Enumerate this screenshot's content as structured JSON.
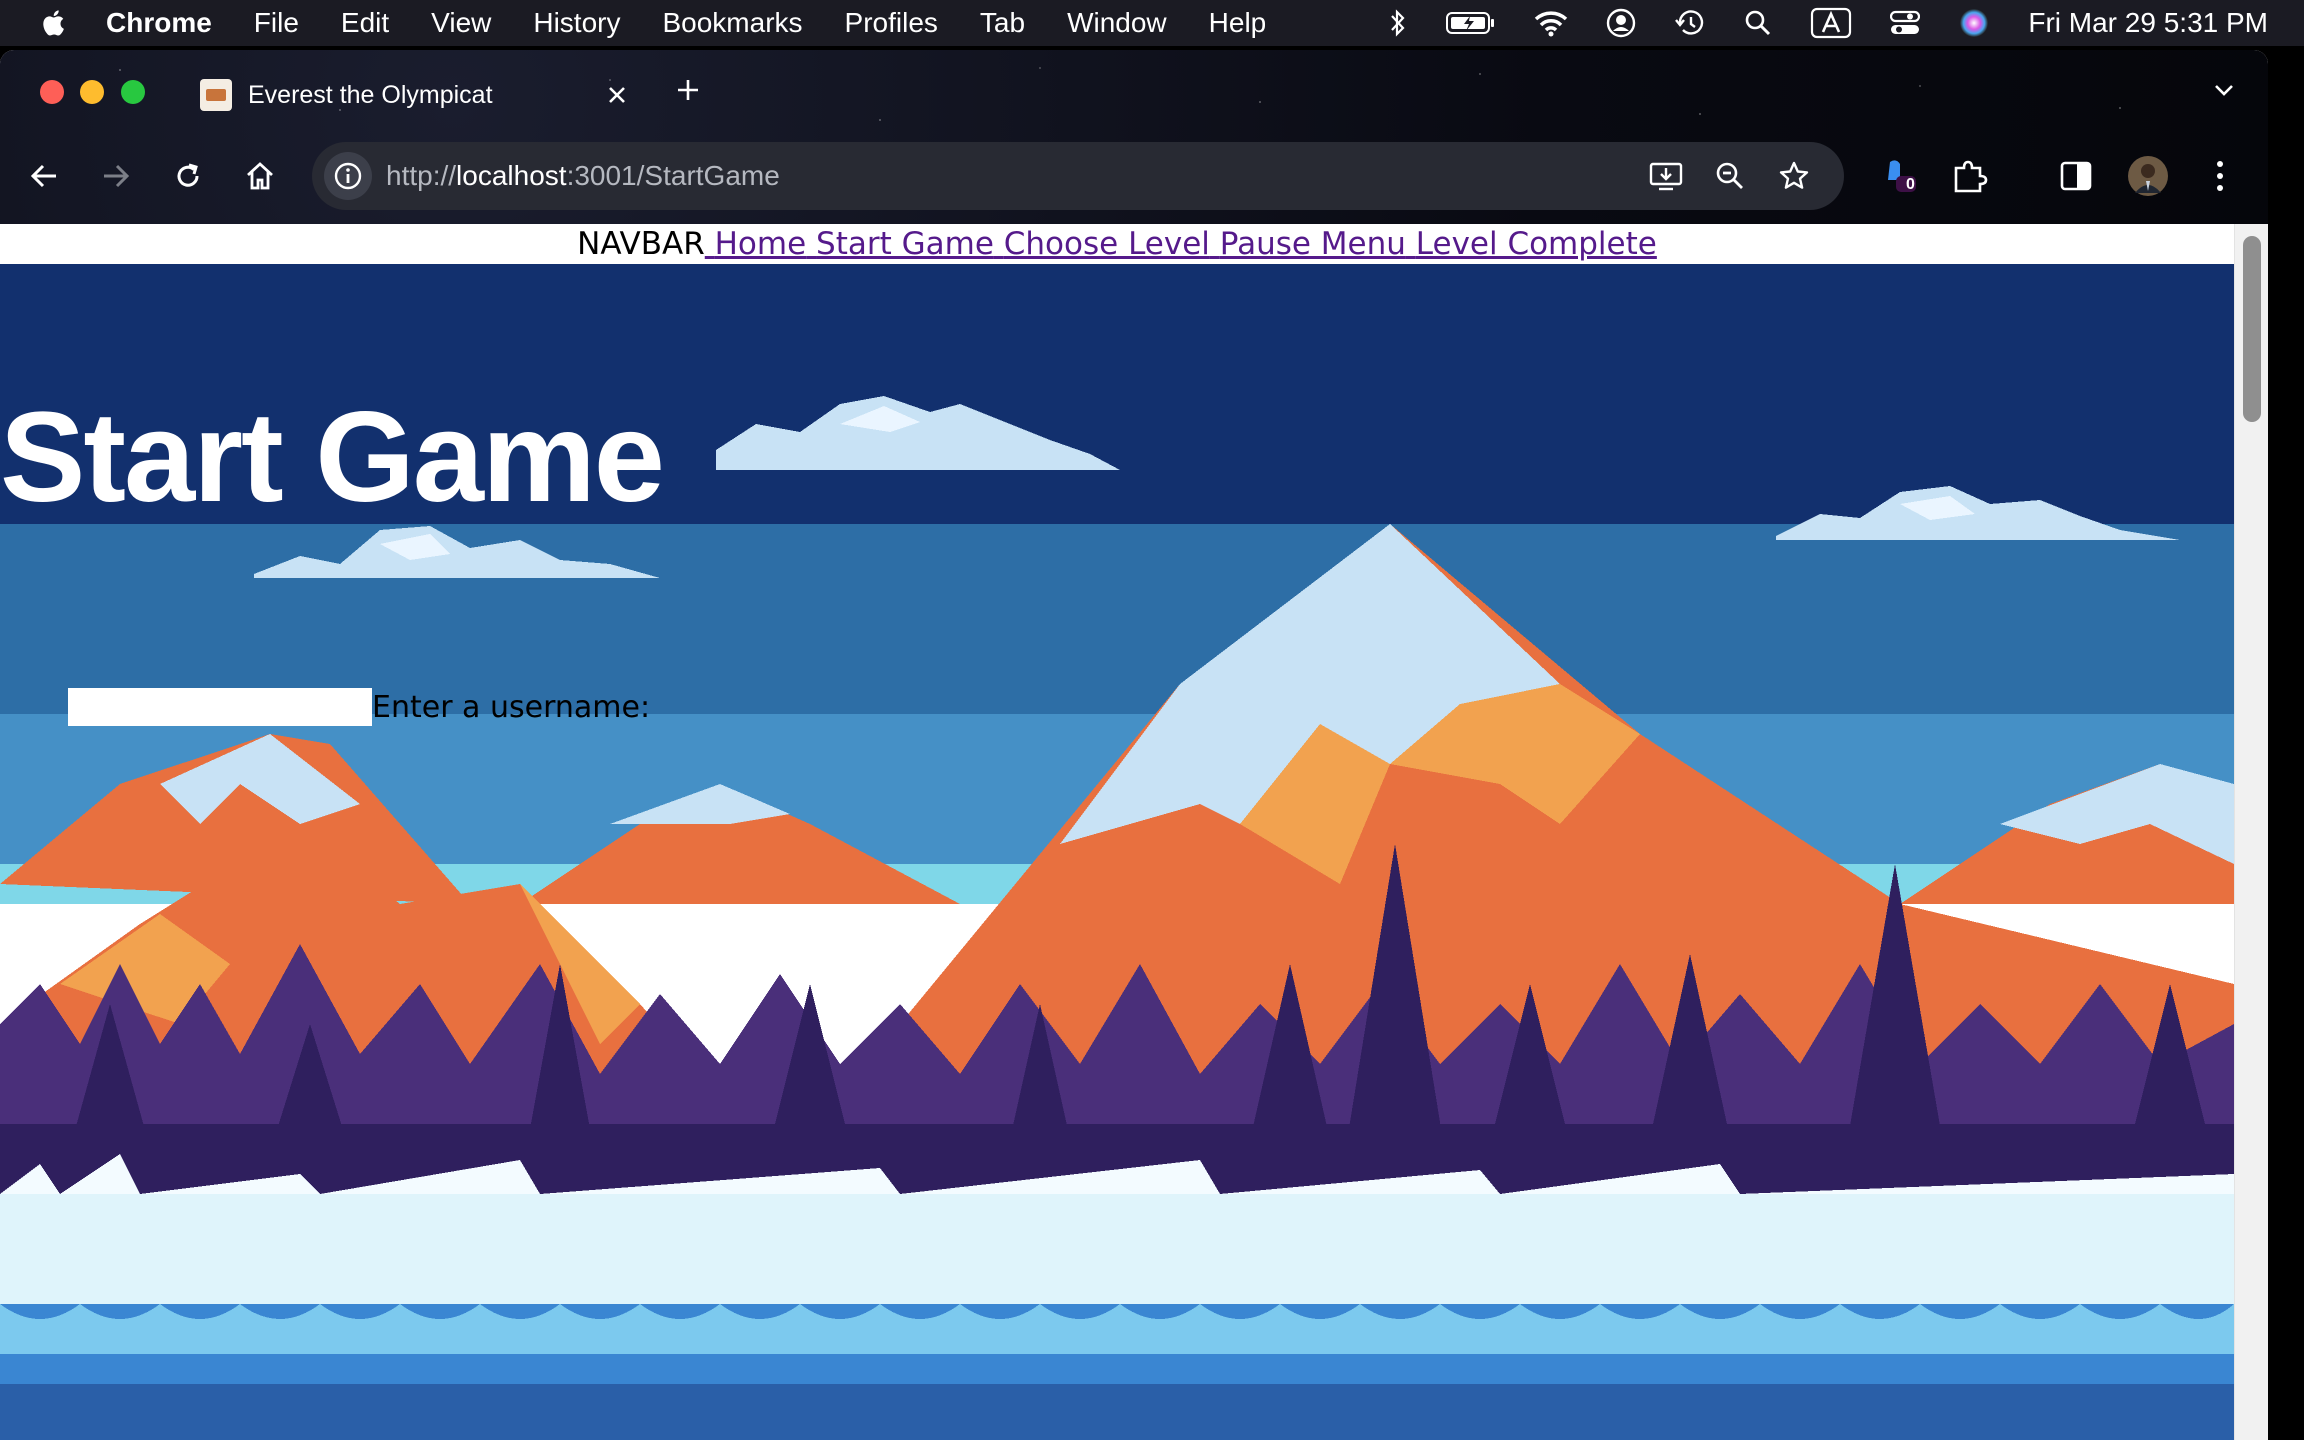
{
  "menubar": {
    "app_name": "Chrome",
    "items": [
      "File",
      "Edit",
      "View",
      "History",
      "Bookmarks",
      "Profiles",
      "Tab",
      "Window",
      "Help"
    ],
    "clock": "Fri Mar 29  5:31 PM"
  },
  "browser": {
    "tab_title": "Everest the Olympicat",
    "url_scheme": "http://",
    "url_host": "localhost",
    "url_rest": ":3001/StartGame",
    "extension_badge": "0"
  },
  "navbar": {
    "label": "NAVBAR",
    "links": [
      "Home",
      "Start Game",
      "Choose Level",
      "Pause Menu",
      "Level Complete"
    ]
  },
  "page": {
    "title": "Start Game",
    "username_label": "Enter a username:",
    "username_value": ""
  },
  "colors": {
    "sky_top": "#12306e",
    "sky_band": "#2d6ea6",
    "mountain_orange": "#e8703f",
    "mountain_light": "#f2a24f",
    "snow": "#c8e2f5",
    "tree": "#2f1f5e",
    "link": "#551a8b"
  }
}
